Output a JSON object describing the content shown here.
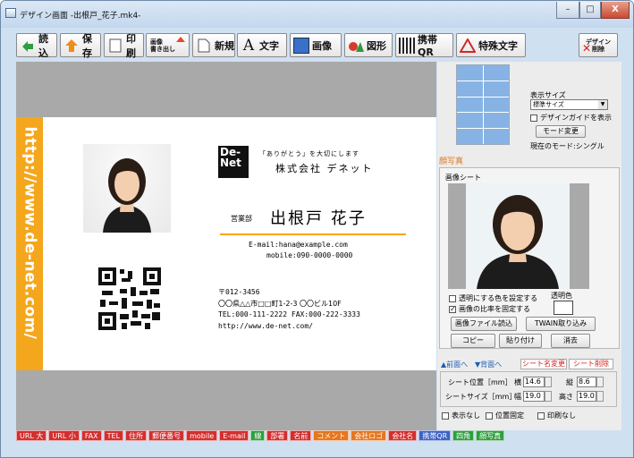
{
  "window": {
    "title": "デザイン画面 -出根戸_花子.mk4-",
    "minimize": "–",
    "maximize": "□",
    "close": "X"
  },
  "toolbar": {
    "load": "読込",
    "save": "保存",
    "print": "印刷",
    "export_line1": "画像",
    "export_line2": "書き出し",
    "new": "新規",
    "text": "文字",
    "image": "画像",
    "shape": "図形",
    "qr": "携帯QR",
    "special": "特殊文字",
    "delete_line1": "デザイン",
    "delete_line2": "削除"
  },
  "card": {
    "url_vertical": "http://www.de-net.com/",
    "logo_line1": "De-",
    "logo_line2": "Net",
    "tagline": "「ありがとう」を大切にします",
    "company": "株式会社 デネット",
    "dept": "営業部",
    "name": "出根戸 花子",
    "email": "E-mail:hana@example.com",
    "mobile": "mobile:090-0000-0000",
    "postal": "〒012-3456",
    "address": "〇〇県△△市□□町1-2-3 〇〇ビル10F",
    "tel_fax": "TEL:000-111-2222 FAX:000-222-3333",
    "url": "http://www.de-net.com/"
  },
  "side": {
    "display_size_label": "表示サイズ",
    "display_size_value": "標準サイズ",
    "guide_label": "デザインガイドを表示",
    "mode_button": "モード変更",
    "current_mode": "現在のモード:シングル",
    "photo_tab": "顔写真",
    "image_sheet_label": "画像シート",
    "transparent_label": "透明にする色を設定する",
    "transparent_color_label": "透明色",
    "fix_ratio_label": "画像の比率を固定する",
    "image_file_button": "画像ファイル読込",
    "twain_button": "TWAIN取り込み",
    "copy_button": "コピー",
    "paste_button": "貼り付け",
    "erase_button": "消去",
    "front_button": "▲前面へ",
    "back_button": "▼背面へ",
    "rename_button": "シート名変更",
    "delete_sheet_button": "シート削除",
    "sheet_pos_label": "シート位置［mm］",
    "horizontal": "横",
    "horizontal_value": "14.6",
    "vertical": "縦",
    "vertical_value": "8.6",
    "sheet_size_label": "シートサイズ［mm］",
    "width": "幅",
    "width_value": "19.0",
    "height": "高さ",
    "height_value": "19.0",
    "hide_label": "表示なし",
    "lock_pos_label": "位置固定",
    "no_print_label": "印刷なし"
  },
  "status_tags": [
    {
      "label": "URL 大",
      "color": "#d32f2f"
    },
    {
      "label": "URL 小",
      "color": "#d32f2f"
    },
    {
      "label": "FAX",
      "color": "#d32f2f"
    },
    {
      "label": "TEL",
      "color": "#d32f2f"
    },
    {
      "label": "住所",
      "color": "#d32f2f"
    },
    {
      "label": "郵便番号",
      "color": "#d32f2f"
    },
    {
      "label": "mobile",
      "color": "#d32f2f"
    },
    {
      "label": "E-mail",
      "color": "#d32f2f"
    },
    {
      "label": "線",
      "color": "#2e9e3e"
    },
    {
      "label": "部署",
      "color": "#d32f2f"
    },
    {
      "label": "名前",
      "color": "#d32f2f"
    },
    {
      "label": "コメント",
      "color": "#e6761f"
    },
    {
      "label": "会社ロゴ",
      "color": "#e6761f"
    },
    {
      "label": "会社名",
      "color": "#d32f2f"
    },
    {
      "label": "携帯QR",
      "color": "#3f63c4"
    },
    {
      "label": "四角",
      "color": "#2e9e3e"
    },
    {
      "label": "顔写真",
      "color": "#2e9e3e"
    }
  ],
  "colors": {
    "accent_orange": "#f4a71c",
    "card_line": "#f4a71c",
    "gray_canvas": "#a9a9a9",
    "layout_blue": "#87b3e4"
  }
}
